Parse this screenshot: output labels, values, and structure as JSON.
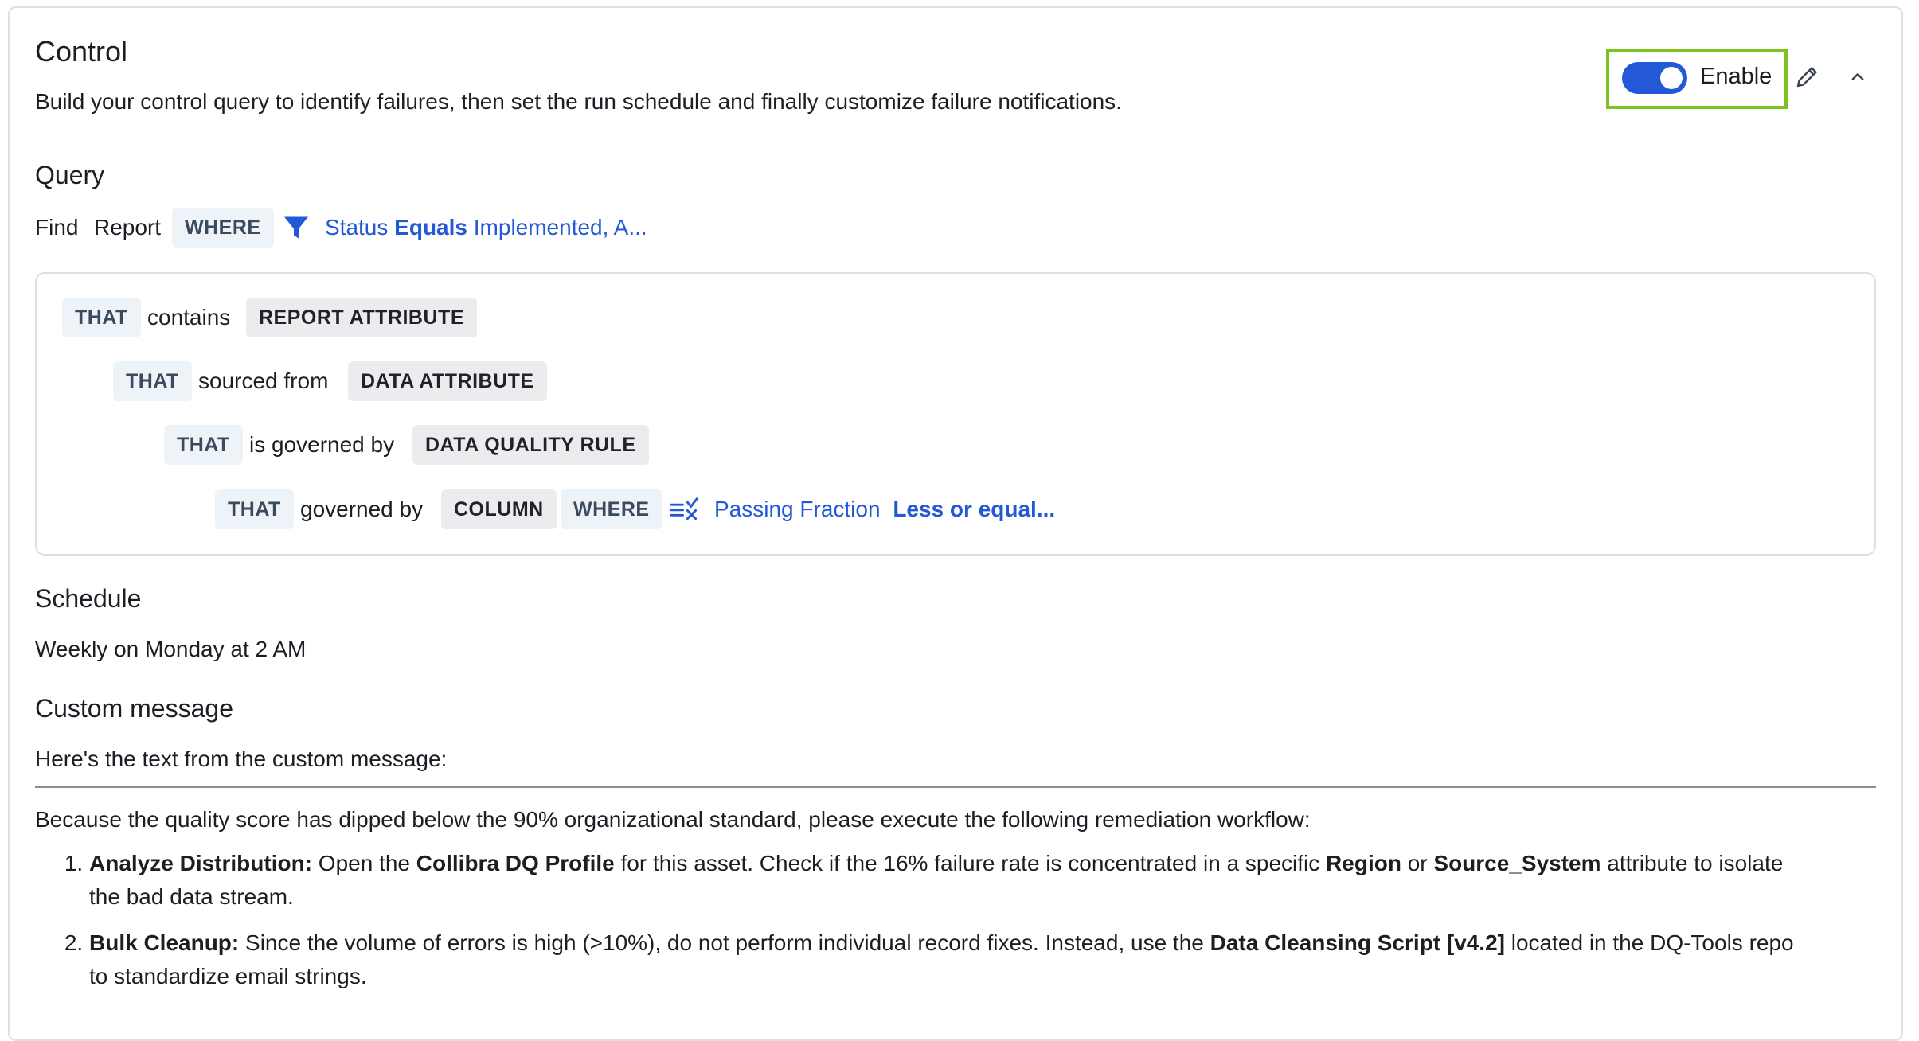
{
  "control": {
    "title": "Control",
    "description": "Build your control query to identify failures, then set the run schedule and finally customize failure notifications.",
    "enable_label": "Enable",
    "enabled": true
  },
  "query": {
    "title": "Query",
    "find_label": "Find",
    "asset_type": "Report",
    "where_keyword": "WHERE",
    "filter": {
      "field": "Status",
      "operator": "Equals",
      "value": "Implemented, A..."
    },
    "relations": [
      {
        "keyword": "THAT",
        "relation": "contains",
        "entity": "REPORT ATTRIBUTE"
      },
      {
        "keyword": "THAT",
        "relation": "sourced from",
        "entity": "DATA ATTRIBUTE"
      },
      {
        "keyword": "THAT",
        "relation": "is governed by",
        "entity": "DATA QUALITY RULE"
      },
      {
        "keyword": "THAT",
        "relation": "governed by",
        "entity": "COLUMN",
        "where_keyword": "WHERE",
        "filter": {
          "field": "Passing Fraction",
          "operator": "Less or equal..."
        }
      }
    ]
  },
  "schedule": {
    "title": "Schedule",
    "value": "Weekly on Monday at 2 AM"
  },
  "custom_message": {
    "title": "Custom message",
    "intro": "Here's the text from the custom message:",
    "body_intro": "Because the quality score has dipped below the 90% organizational standard, please execute the following remediation workflow:",
    "steps": [
      {
        "label": "Analyze Distribution:",
        "t1": " Open the ",
        "b1": "Collibra DQ Profile",
        "t2": " for this asset. Check if the 16% failure rate is concentrated in a specific ",
        "b2": "Region",
        "t3": " or ",
        "b3": "Source_System",
        "t4": " attribute to isolate the bad data stream."
      },
      {
        "label": "Bulk Cleanup:",
        "t1": " Since the volume of errors is high (>10%), do not perform individual record fixes. Instead, use the ",
        "b1": "Data Cleansing Script [v4.2]",
        "t2": " located in the DQ-Tools repo to standardize email strings."
      }
    ]
  },
  "colors": {
    "accent": "#2359d6",
    "highlight_border": "#7dc31f",
    "chip_keyword_bg": "#eef3f8",
    "chip_entity_bg": "#ececee"
  }
}
